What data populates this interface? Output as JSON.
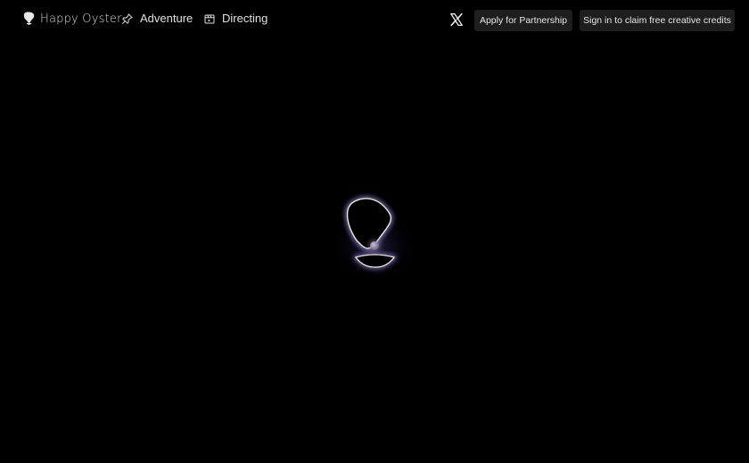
{
  "header": {
    "brand": {
      "name": "Happy Oyster",
      "logo_icon": "oyster-logo-icon"
    },
    "nav": [
      {
        "label": "Adventure",
        "icon": "pin-icon"
      },
      {
        "label": "Directing",
        "icon": "clapper-icon"
      }
    ],
    "social": {
      "icon": "x-logo-icon"
    },
    "partnership_label": "Apply for Partnership",
    "signin_label": "Sign in to claim free creative credits"
  },
  "stage": {
    "loader_icon": "oyster-pearl-icon",
    "colors": {
      "background": "#000000",
      "glow": "#a8a0ff",
      "rim": "#f2e7d8",
      "pearl": "#9a8fa6"
    }
  }
}
